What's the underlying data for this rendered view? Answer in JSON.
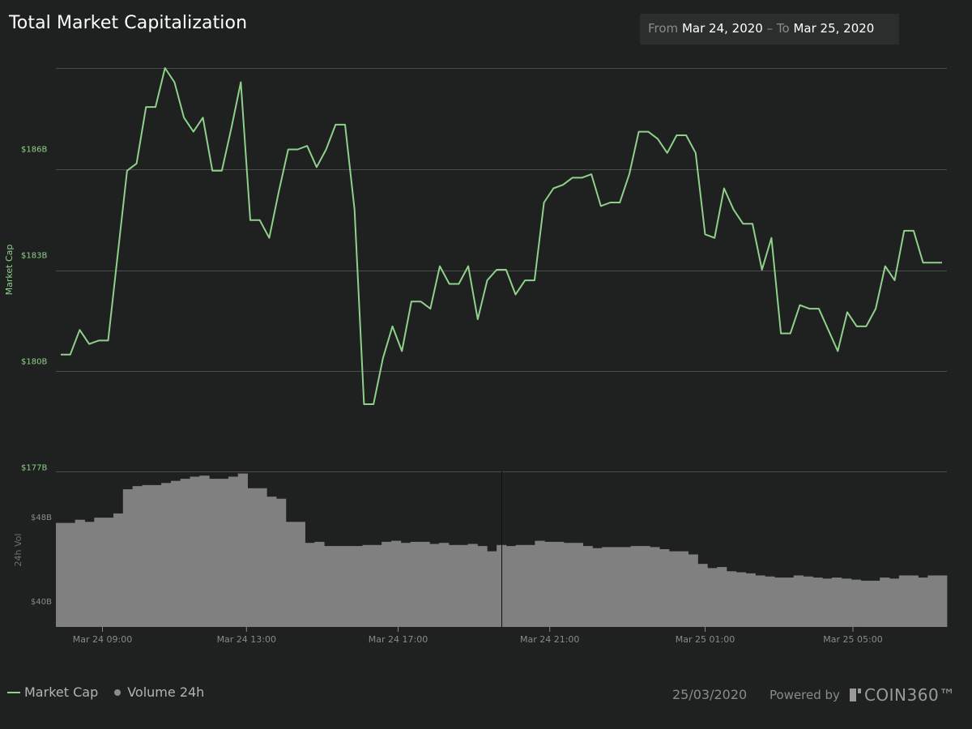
{
  "header": {
    "title": "Total Market Capitalization",
    "range_from_label": "From",
    "range_from": "Mar 24, 2020",
    "range_sep": "–",
    "range_to_label": "To",
    "range_to": "Mar 25, 2020"
  },
  "footer": {
    "legend_market_cap": "Market Cap",
    "legend_volume": "Volume 24h",
    "date": "25/03/2020",
    "powered_by": "Powered by",
    "brand": "COIN360™"
  },
  "colors": {
    "background": "#1f2020",
    "line": "#8fd18a",
    "volume_bars": "#808080",
    "grid": "#4a4b4b"
  },
  "chart_data": [
    {
      "type": "line",
      "ylabel": "Market Cap",
      "y_ticks": [
        {
          "value": 186,
          "label": "$186B"
        },
        {
          "value": 183,
          "label": "$183B"
        },
        {
          "value": 180,
          "label": "$180B"
        },
        {
          "value": 177,
          "label": "$177B"
        }
      ],
      "ylim": [
        176.9,
        188.3
      ],
      "x_ticks": [
        "Mar 24 09:00",
        "Mar 24 13:00",
        "Mar 24 17:00",
        "Mar 24 21:00",
        "Mar 25 01:00",
        "Mar 25 05:00"
      ],
      "x_tick_positions": [
        1.1,
        4.9,
        8.9,
        12.9,
        17.0,
        20.9
      ],
      "grid": true,
      "series": [
        {
          "name": "Market Cap",
          "x": [
            0,
            0.25,
            0.5,
            0.75,
            1,
            1.25,
            1.5,
            1.75,
            2,
            2.25,
            2.5,
            2.75,
            3,
            3.25,
            3.5,
            3.75,
            4,
            4.25,
            4.5,
            4.75,
            5,
            5.25,
            5.5,
            5.75,
            6,
            6.25,
            6.5,
            6.75,
            7,
            7.25,
            7.5,
            7.75,
            8,
            8.25,
            8.5,
            8.75,
            9,
            9.25,
            9.5,
            9.75,
            10,
            10.25,
            10.5,
            10.75,
            11,
            11.25,
            11.5,
            11.75,
            12,
            12.25,
            12.5,
            12.75,
            13,
            13.25,
            13.5,
            13.75,
            14,
            14.25,
            14.5,
            14.75,
            15,
            15.25,
            15.5,
            15.75,
            16,
            16.25,
            16.5,
            16.75,
            17,
            17.25,
            17.5,
            17.75,
            18,
            18.25,
            18.5,
            18.75,
            19,
            19.25,
            19.5,
            19.75,
            20,
            20.25,
            20.5,
            20.75,
            21,
            21.25,
            21.5,
            21.75,
            22,
            22.25,
            22.5,
            22.75,
            23,
            23.25
          ],
          "values": [
            180.2,
            180.2,
            180.9,
            180.5,
            180.6,
            180.6,
            183.0,
            185.4,
            185.6,
            187.2,
            187.2,
            188.3,
            187.9,
            186.9,
            186.5,
            186.9,
            185.4,
            185.4,
            186.6,
            187.9,
            184.0,
            184.0,
            183.5,
            184.8,
            186.0,
            186.0,
            186.1,
            185.5,
            186.0,
            186.7,
            186.7,
            184.3,
            178.8,
            178.8,
            180.1,
            181.0,
            180.3,
            181.7,
            181.7,
            181.5,
            182.7,
            182.2,
            182.2,
            182.7,
            181.2,
            182.3,
            182.6,
            182.6,
            181.9,
            182.3,
            182.3,
            184.5,
            184.9,
            185.0,
            185.2,
            185.2,
            185.3,
            184.4,
            184.5,
            184.5,
            185.3,
            186.5,
            186.5,
            186.3,
            185.9,
            186.4,
            186.4,
            185.9,
            183.6,
            183.5,
            184.9,
            184.3,
            183.9,
            183.9,
            182.6,
            183.5,
            180.8,
            180.8,
            181.6,
            181.5,
            181.5,
            180.9,
            180.3,
            181.4,
            181.0,
            181.0,
            181.5,
            182.7,
            182.3,
            183.7,
            183.7,
            182.8,
            182.8,
            182.8
          ]
        }
      ]
    },
    {
      "type": "bar",
      "ylabel": "24h Vol",
      "y_ticks": [
        {
          "value": 48,
          "label": "$48B"
        },
        {
          "value": 40,
          "label": "$40B"
        }
      ],
      "ylim": [
        37.6,
        52.4
      ],
      "series": [
        {
          "name": "Volume 24h",
          "values": [
            47.5,
            47.5,
            47.8,
            47.6,
            48.0,
            48.0,
            48.4,
            50.7,
            51.0,
            51.1,
            51.1,
            51.3,
            51.5,
            51.7,
            51.9,
            52.0,
            51.7,
            51.7,
            51.9,
            52.2,
            50.8,
            50.8,
            50.0,
            49.8,
            47.6,
            47.6,
            45.6,
            45.7,
            45.3,
            45.3,
            45.3,
            45.3,
            45.4,
            45.4,
            45.7,
            45.8,
            45.6,
            45.7,
            45.7,
            45.5,
            45.6,
            45.4,
            45.4,
            45.5,
            45.3,
            44.8,
            45.4,
            45.3,
            45.4,
            45.4,
            45.8,
            45.7,
            45.7,
            45.6,
            45.6,
            45.3,
            45.1,
            45.2,
            45.2,
            45.2,
            45.3,
            45.3,
            45.2,
            45.0,
            44.8,
            44.8,
            44.5,
            43.6,
            43.2,
            43.3,
            42.9,
            42.8,
            42.7,
            42.5,
            42.4,
            42.3,
            42.3,
            42.5,
            42.4,
            42.3,
            42.2,
            42.3,
            42.2,
            42.1,
            42.0,
            42.0,
            42.3,
            42.2,
            42.5,
            42.5,
            42.3,
            42.5,
            42.5
          ]
        }
      ]
    }
  ]
}
